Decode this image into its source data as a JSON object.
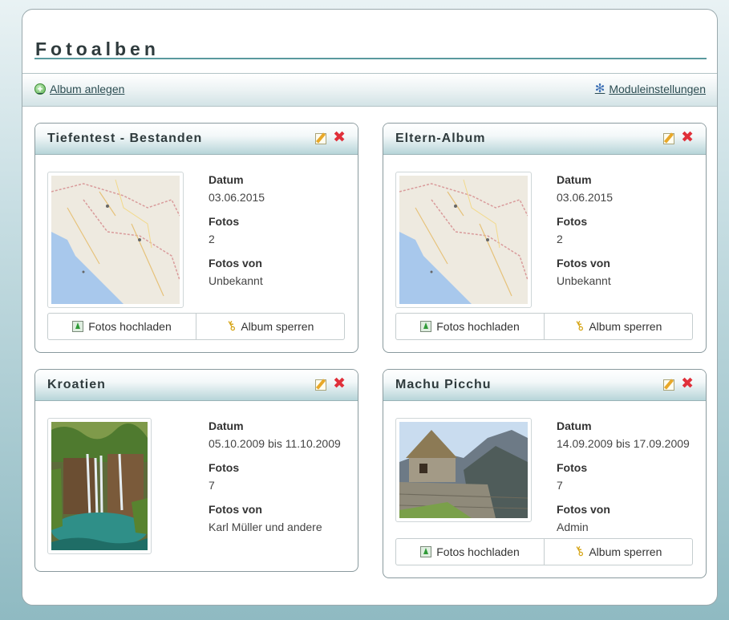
{
  "page": {
    "title": "Fotoalben"
  },
  "toolbar": {
    "add_label": "Album anlegen",
    "settings_label": "Moduleinstellungen"
  },
  "labels": {
    "date": "Datum",
    "photos": "Fotos",
    "photos_by": "Fotos von"
  },
  "actions": {
    "upload": "Fotos hochladen",
    "lock": "Album sperren"
  },
  "albums": [
    {
      "title": "Tiefentest - Bestanden",
      "date": "03.06.2015",
      "photos": "2",
      "photos_by": "Unbekannt",
      "thumb": "map-croatia-icon"
    },
    {
      "title": "Eltern-Album",
      "date": "03.06.2015",
      "photos": "2",
      "photos_by": "Unbekannt",
      "thumb": "map-croatia-icon"
    },
    {
      "title": "Kroatien",
      "date": "05.10.2009 bis 11.10.2009",
      "photos": "7",
      "photos_by": "Karl Müller und andere",
      "thumb": "waterfall-photo"
    },
    {
      "title": "Machu Picchu",
      "date": "14.09.2009 bis 17.09.2009",
      "photos": "7",
      "photos_by": "Admin",
      "thumb": "stone-hut-photo"
    }
  ],
  "colors": {
    "accent": "#5a999e",
    "delete": "#e0303a"
  }
}
